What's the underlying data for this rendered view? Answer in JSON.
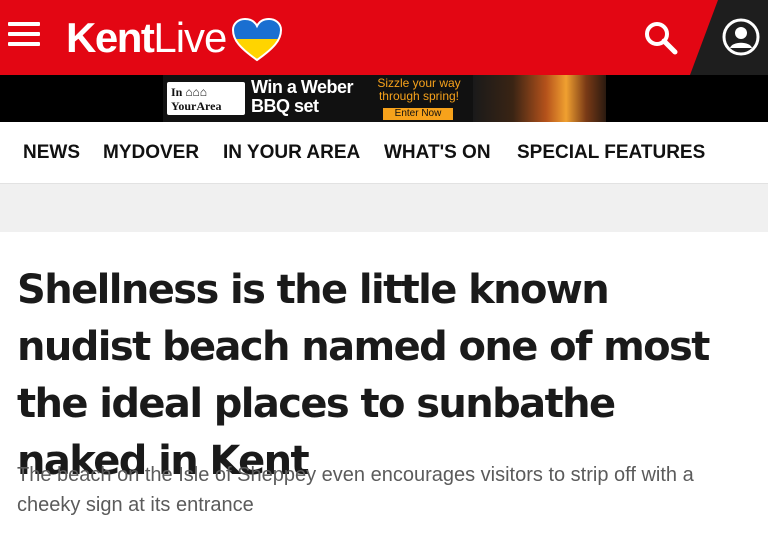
{
  "header": {
    "logo_bold": "Kent",
    "logo_light": "Live",
    "brand_color": "#e30613",
    "icons": {
      "menu": "hamburger-menu-icon",
      "heart": "ukraine-heart-icon",
      "search": "search-icon",
      "account": "account-icon"
    }
  },
  "ad": {
    "badge_line1": "In ⌂⌂⌂",
    "badge_line2": "YourArea",
    "title_line1": "Win a Weber",
    "title_line2": "BBQ set",
    "sub_line1": "Sizzle your way",
    "sub_line2": "through spring!",
    "cta": "Enter Now"
  },
  "nav": {
    "items": [
      {
        "label": "NEWS"
      },
      {
        "label": "MYDOVER"
      },
      {
        "label": "IN YOUR AREA"
      },
      {
        "label": "WHAT'S ON"
      },
      {
        "label": "SPECIAL FEATURES"
      }
    ]
  },
  "article": {
    "headline": "Shellness is the little known nudist beach named one of most the ideal places to sunbathe naked in Kent",
    "standfirst": "The beach on the Isle of Sheppey even encourages visitors to strip off with a cheeky sign at its entrance"
  }
}
